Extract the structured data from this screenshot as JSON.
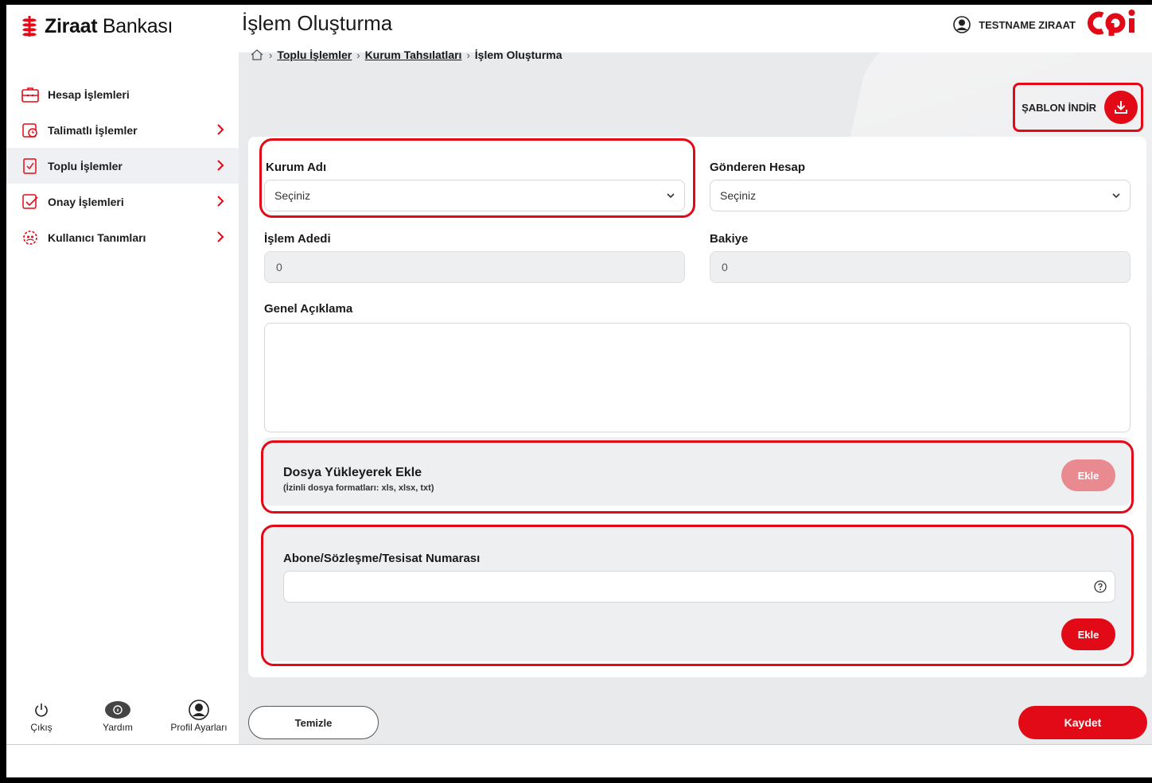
{
  "brand": {
    "name_bold": "Ziraat",
    "name_regular": " Bankası"
  },
  "page": {
    "title": "İşlem Oluşturma"
  },
  "breadcrumb": {
    "items": [
      "Toplu İşlemler",
      "Kurum Tahsılatları",
      "İşlem Oluşturma"
    ]
  },
  "user": {
    "name": "TESTNAME ZIRAAT"
  },
  "sidebar": {
    "items": [
      {
        "label": "Hesap İşlemleri",
        "icon": "briefcase-icon"
      },
      {
        "label": "Talimatlı İşlemler",
        "icon": "calendar-clock-icon"
      },
      {
        "label": "Toplu İşlemler",
        "icon": "document-check-icon"
      },
      {
        "label": "Onay İşlemleri",
        "icon": "approve-icon"
      },
      {
        "label": "Kullanıcı Tanımları",
        "icon": "users-gear-icon"
      }
    ],
    "bottom": {
      "logout": "Çıkış",
      "help": "Yardım",
      "profile": "Profil Ayarları"
    }
  },
  "toolbar": {
    "template_download": "ŞABLON İNDİR"
  },
  "form": {
    "kurum_label": "Kurum Adı",
    "kurum_value": "Seçiniz",
    "hesap_label": "Gönderen Hesap",
    "hesap_value": "Seçiniz",
    "adet_label": "İşlem Adedi",
    "adet_value": "0",
    "bakiye_label": "Bakiye",
    "bakiye_value": "0",
    "aciklama_label": "Genel Açıklama"
  },
  "upload": {
    "title": "Dosya Yükleyerek Ekle",
    "subtitle": "(İzinli dosya formatları: xls, xlsx, txt)",
    "button": "Ekle"
  },
  "abone": {
    "label": "Abone/Sözleşme/Tesisat Numarası",
    "button": "Ekle"
  },
  "actions": {
    "clear": "Temizle",
    "save": "Kaydet"
  },
  "colors": {
    "accent": "#e30a17"
  }
}
